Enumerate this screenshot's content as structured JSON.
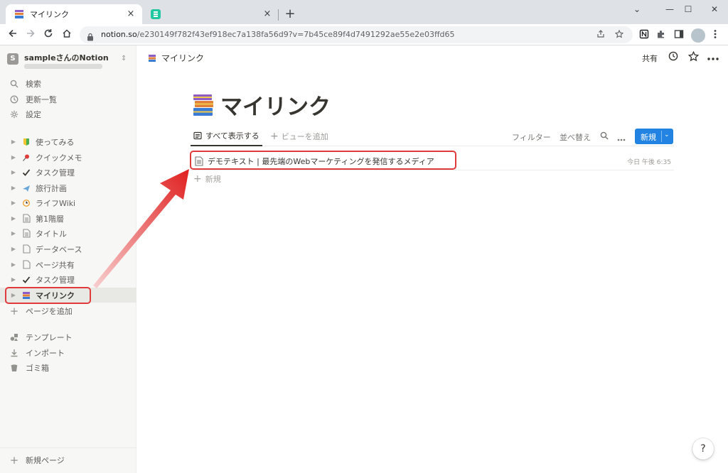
{
  "browser": {
    "tabs": [
      {
        "title": "マイリンク",
        "close": "×"
      },
      {
        "title": "",
        "close": "×"
      }
    ],
    "new_tab": "+",
    "window_controls": [
      "⌄",
      "—",
      "☐",
      "✕"
    ],
    "url_host": "notion.so",
    "url_path": "/e230149f782f43ef918ec7a138fa56d9?v=7b45ce89f4d7491292ae55e2e03ffd65"
  },
  "sidebar": {
    "workspace_badge": "S",
    "workspace_name": "sampleさんのNotion",
    "actions": [
      {
        "label": "検索",
        "icon": "search-icon"
      },
      {
        "label": "更新一覧",
        "icon": "clock-icon"
      },
      {
        "label": "設定",
        "icon": "gear-icon"
      }
    ],
    "pages": [
      {
        "label": "使ってみる",
        "icon": "beginner-icon"
      },
      {
        "label": "クイックメモ",
        "icon": "pin-icon"
      },
      {
        "label": "タスク管理",
        "icon": "check-icon"
      },
      {
        "label": "旅行計画",
        "icon": "airplane-icon"
      },
      {
        "label": "ライフWiki",
        "icon": "clock-icon"
      },
      {
        "label": "第1階層",
        "icon": "document-icon"
      },
      {
        "label": "タイトル",
        "icon": "document-icon"
      },
      {
        "label": "データベース",
        "icon": "document-icon"
      },
      {
        "label": "ページ共有",
        "icon": "document-icon"
      },
      {
        "label": "タスク管理",
        "icon": "check-icon"
      },
      {
        "label": "マイリンク",
        "icon": "books-icon",
        "selected": true
      }
    ],
    "add_page": "ページを追加",
    "tools": [
      {
        "label": "テンプレート",
        "icon": "shapes-icon"
      },
      {
        "label": "インポート",
        "icon": "download-icon"
      },
      {
        "label": "ゴミ箱",
        "icon": "trash-icon"
      }
    ],
    "new_page": "新規ページ"
  },
  "topbar": {
    "breadcrumb": "マイリンク",
    "share": "共有"
  },
  "page": {
    "title": "マイリンク",
    "view_active": "すべて表示する",
    "add_view": "ビューを追加",
    "filter": "フィルター",
    "sort": "並べ替え",
    "new_button": "新規",
    "rows": [
      {
        "title": "デモテキスト | 最先端のWebマーケティングを発信するメディア",
        "time": "今日 午後 6:35"
      }
    ],
    "add_row": "新規",
    "help": "?"
  },
  "colors": {
    "accent_blue": "#2383e2",
    "highlight_red": "#e03b3b",
    "sidebar_bg": "#f7f7f5"
  }
}
